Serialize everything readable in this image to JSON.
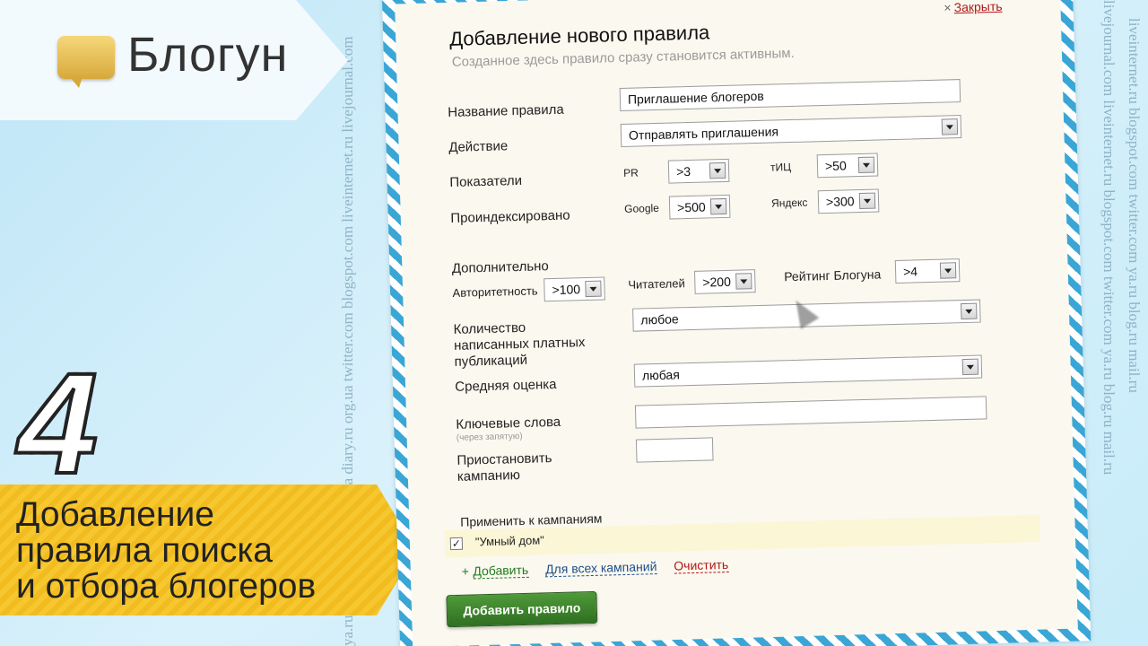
{
  "background": {
    "left_text": "ya.ru blog.ru mail.ru org.ua diary.ru org.ua twitter.com blogspot.com liveinternet.ru livejournal.com",
    "right_text_1": "livejournal.com liveinternet.ru blogspot.com twitter.com ya.ru blog.ru mail.ru",
    "right_text_2": "liveinternet.ru blogspot.com twitter.com ya.ru blog.ru mail.ru"
  },
  "logo": {
    "text": "Блогун"
  },
  "step": {
    "number": "4"
  },
  "title_banner": {
    "line1": "Добавление",
    "line2": "правила поиска",
    "line3": "и отбора блогеров"
  },
  "dialog": {
    "close": "Закрыть",
    "close_x": "×",
    "title": "Добавление нового правила",
    "subtitle": "Созданное здесь правило сразу становится активным.",
    "rule_name_label": "Название правила",
    "rule_name_value": "Приглашение блогеров",
    "action_label": "Действие",
    "action_value": "Отправлять приглашения",
    "metrics_label": "Показатели",
    "pr_label": "PR",
    "pr_value": ">3",
    "tic_label": "тИЦ",
    "tic_value": ">50",
    "indexed_label": "Проиндексировано",
    "google_label": "Google",
    "google_value": ">500",
    "yandex_label": "Яндекс",
    "yandex_value": ">300",
    "extra_label": "Дополнительно",
    "authority_label": "Авторитетность",
    "authority_value": ">100",
    "readers_label": "Читателей",
    "readers_value": ">200",
    "rating_label": "Рейтинг Блогуна",
    "rating_value": ">4",
    "paid_posts_label_1": "Количество",
    "paid_posts_label_2": "написанных платных",
    "paid_posts_label_3": "публикаций",
    "paid_posts_value": "любое",
    "avg_score_label": "Средняя оценка",
    "avg_score_value": "любая",
    "keywords_label": "Ключевые слова",
    "keywords_hint": "(через запятую)",
    "keywords_value": "",
    "pause_label_1": "Приостановить",
    "pause_label_2": "кампанию",
    "pause_value": "",
    "apply_label": "Применить к кампаниям",
    "campaign_name": "\"Умный дом\"",
    "campaign_checked": "✓",
    "add_plus": "+",
    "add_link": "Добавить",
    "all_link": "Для всех кампаний",
    "clear_link": "Очистить",
    "submit": "Добавить правило"
  },
  "colors": {
    "frame_stripe": "#3aa6d6",
    "banner_yellow": "#f6c72f",
    "submit_green": "#3f8a2e",
    "close_red": "#b01818"
  }
}
